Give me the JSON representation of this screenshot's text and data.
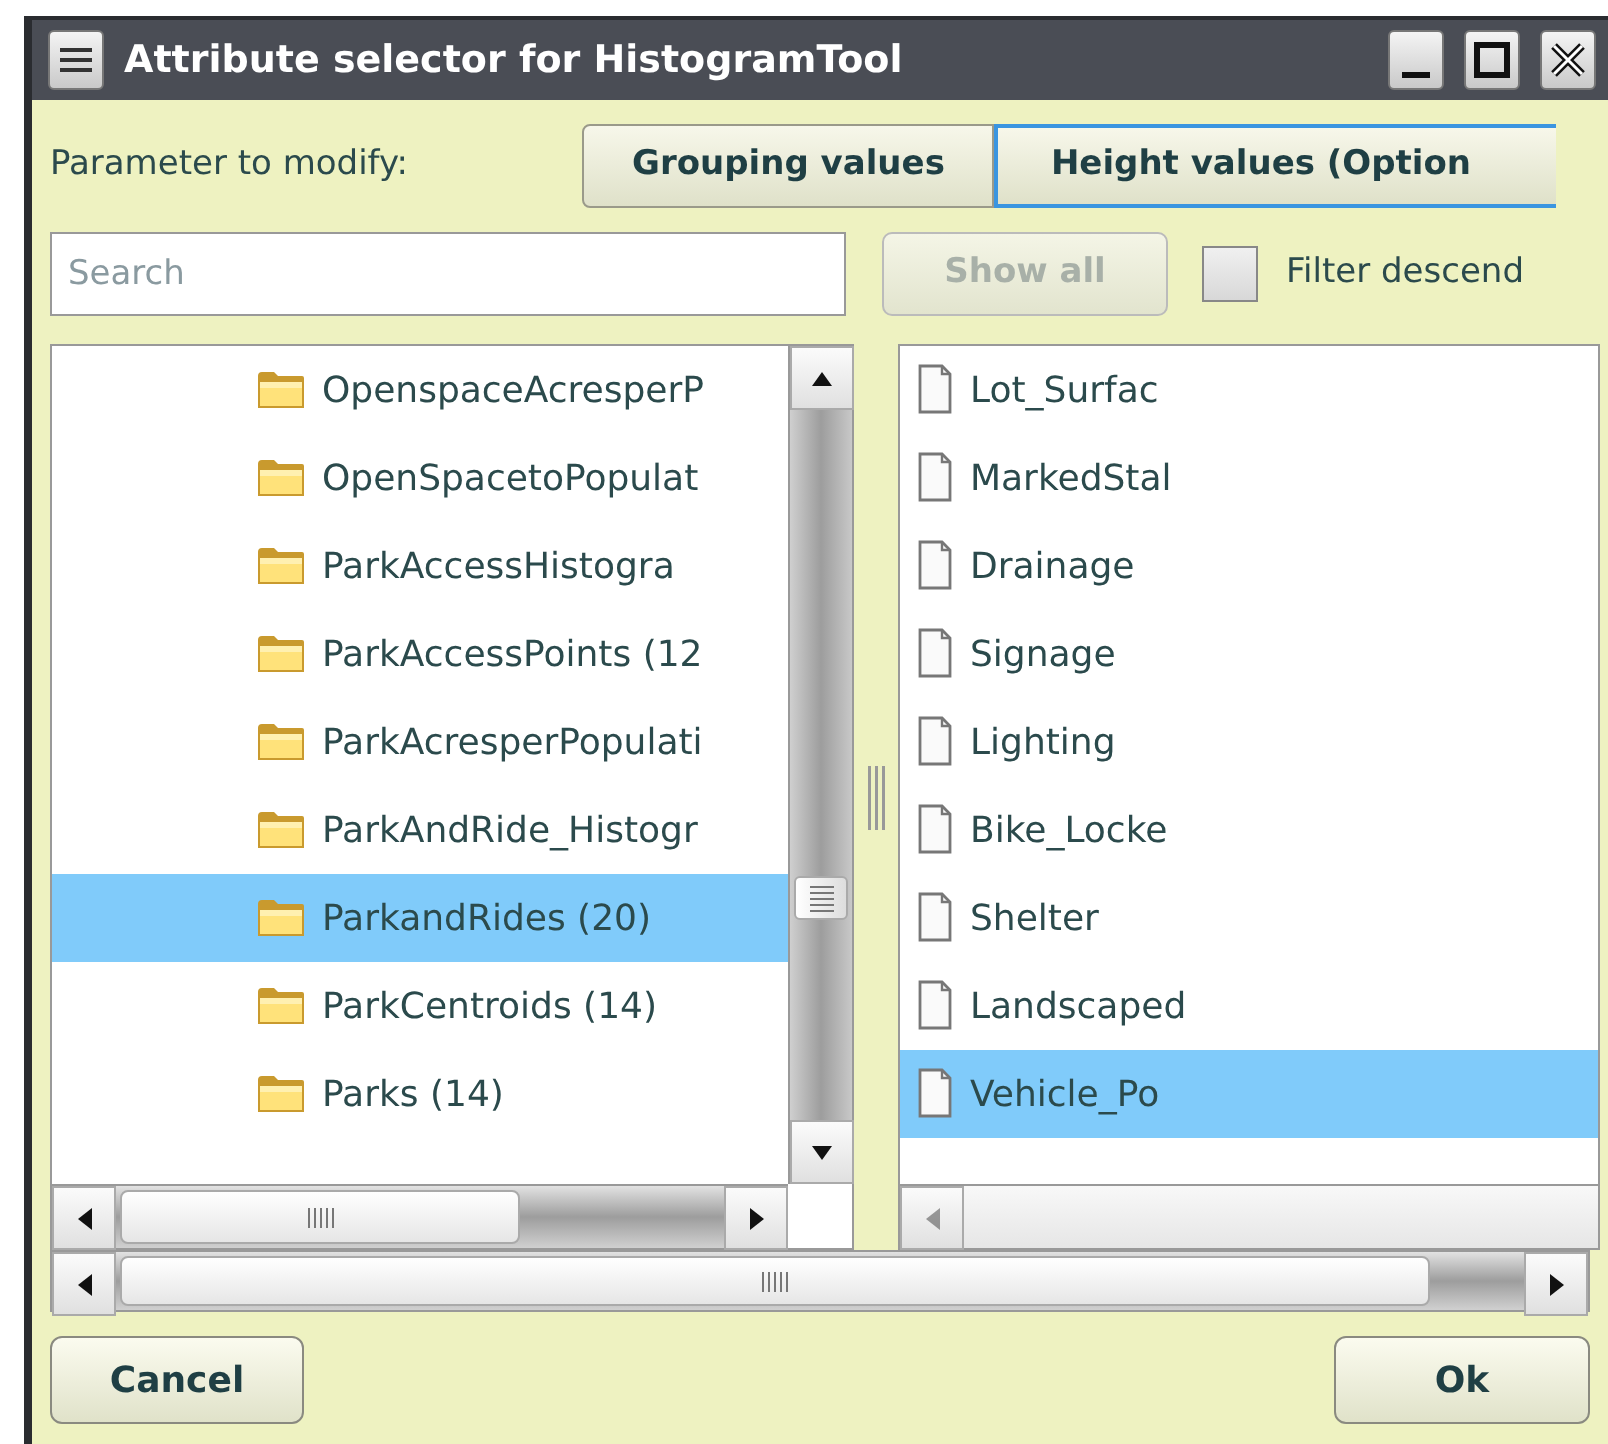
{
  "window": {
    "title": "Attribute selector for HistogramTool"
  },
  "parameter": {
    "label": "Parameter to modify:",
    "tabs": [
      {
        "label": "Grouping values",
        "selected": false
      },
      {
        "label": "Height values (Option",
        "selected": true
      }
    ]
  },
  "search": {
    "placeholder": "Search"
  },
  "show_all": {
    "label": "Show all",
    "disabled": true
  },
  "filter": {
    "label": "Filter descend",
    "checked": false
  },
  "groups": [
    {
      "label": "OpenspaceAcresperP",
      "selected": false
    },
    {
      "label": "OpenSpacetoPopulat",
      "selected": false
    },
    {
      "label": "ParkAccessHistogra",
      "selected": false
    },
    {
      "label": "ParkAccessPoints (12",
      "selected": false
    },
    {
      "label": "ParkAcresperPopulati",
      "selected": false
    },
    {
      "label": "ParkAndRide_Histogr",
      "selected": false
    },
    {
      "label": "ParkandRides (20)",
      "selected": true
    },
    {
      "label": "ParkCentroids (14)",
      "selected": false
    },
    {
      "label": "Parks (14)",
      "selected": false
    }
  ],
  "attributes": [
    {
      "label": "Lot_Surfac",
      "selected": false
    },
    {
      "label": "MarkedStal",
      "selected": false
    },
    {
      "label": "Drainage",
      "selected": false
    },
    {
      "label": "Signage",
      "selected": false
    },
    {
      "label": "Lighting",
      "selected": false
    },
    {
      "label": "Bike_Locke",
      "selected": false
    },
    {
      "label": "Shelter",
      "selected": false
    },
    {
      "label": "Landscaped",
      "selected": false
    },
    {
      "label": "Vehicle_Po",
      "selected": true
    }
  ],
  "buttons": {
    "cancel": "Cancel",
    "ok": "Ok"
  }
}
